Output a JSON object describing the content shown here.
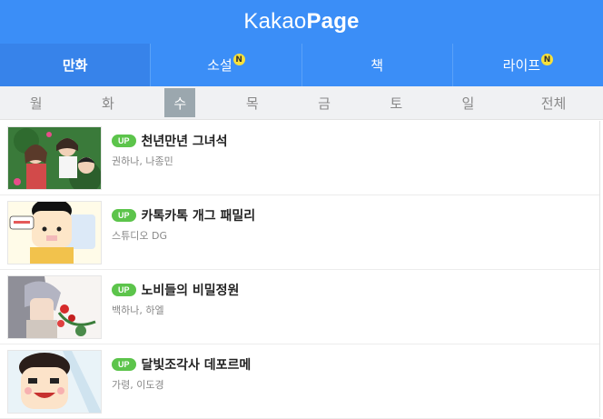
{
  "header": {
    "logo_light": "Kakao",
    "logo_bold": "Page"
  },
  "tabs": [
    {
      "label": "만화",
      "badge": ""
    },
    {
      "label": "소설",
      "badge": "N"
    },
    {
      "label": "책",
      "badge": ""
    },
    {
      "label": "라이프",
      "badge": "N"
    }
  ],
  "days": [
    "월",
    "화",
    "수",
    "목",
    "금",
    "토",
    "일",
    "전체"
  ],
  "active_day": "수",
  "items": [
    {
      "badge": "UP",
      "title": "천년만년 그녀석",
      "author": "권하나, 나종민"
    },
    {
      "badge": "UP",
      "title": "카톡카톡 개그 패밀리",
      "author": "스튜디오 DG"
    },
    {
      "badge": "UP",
      "title": "노비들의 비밀정원",
      "author": "백하나, 하엘"
    },
    {
      "badge": "UP",
      "title": "달빛조각사 데포르메",
      "author": "가령, 이도경"
    }
  ],
  "colors": {
    "brand": "#3b8ef7",
    "up_badge": "#5cc44b",
    "new_badge": "#f7e13a"
  }
}
